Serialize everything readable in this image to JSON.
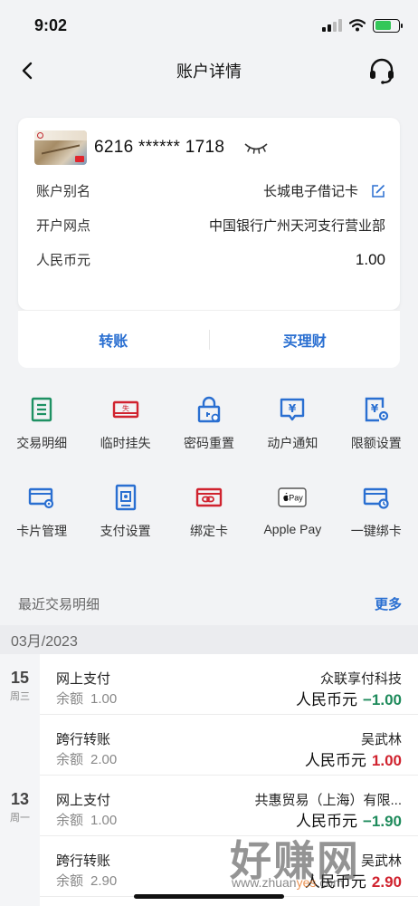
{
  "status": {
    "time": "9:02"
  },
  "nav": {
    "title": "账户详情"
  },
  "account": {
    "card_number": "6216 ****** 1718",
    "rows": [
      {
        "label": "账户别名",
        "value": "长城电子借记卡"
      },
      {
        "label": "开户网点",
        "value": "中国银行广州天河支行营业部"
      },
      {
        "label": "人民币元",
        "value": "1.00"
      }
    ],
    "actions": [
      "转账",
      "买理财"
    ]
  },
  "functions": [
    {
      "label": "交易明细",
      "icon": "list-icon"
    },
    {
      "label": "临时挂失",
      "icon": "report-loss-icon"
    },
    {
      "label": "密码重置",
      "icon": "lock-reset-icon"
    },
    {
      "label": "动户通知",
      "icon": "notice-icon"
    },
    {
      "label": "限额设置",
      "icon": "limit-settings-icon"
    },
    {
      "label": "卡片管理",
      "icon": "card-manage-icon"
    },
    {
      "label": "支付设置",
      "icon": "payment-settings-icon"
    },
    {
      "label": "绑定卡",
      "icon": "bind-card-icon"
    },
    {
      "label": "Apple Pay",
      "icon": "apple-pay-icon"
    },
    {
      "label": "一键绑卡",
      "icon": "quick-bind-icon"
    }
  ],
  "recent": {
    "title": "最近交易明细",
    "more": "更多",
    "month": "03月/2023",
    "dates": [
      {
        "day": "15",
        "week": "周三"
      },
      {
        "day": "13",
        "week": "周一"
      }
    ],
    "transactions": [
      {
        "type": "网上支付",
        "balance_label": "余额",
        "balance": "1.00",
        "party": "众联享付科技",
        "currency": "人民币元",
        "amount": "−1.00"
      },
      {
        "type": "跨行转账",
        "balance_label": "余额",
        "balance": "2.00",
        "party": "吴武林",
        "currency": "人民币元",
        "amount": "1.00"
      },
      {
        "type": "网上支付",
        "balance_label": "余额",
        "balance": "1.00",
        "party": "共惠贸易（上海）有限...",
        "currency": "人民币元",
        "amount": "−1.90"
      },
      {
        "type": "跨行转账",
        "balance_label": "余额",
        "balance": "2.90",
        "party": "吴武林",
        "currency": "人民币元",
        "amount": "2.90"
      }
    ]
  },
  "watermark": {
    "text": "好赚网",
    "url_a": "www.zhuan",
    "url_b": "yes",
    "url_c": ".com"
  },
  "colors": {
    "accent": "#2a6fd1",
    "negative": "#1f8b5c",
    "positive": "#d0222e"
  }
}
